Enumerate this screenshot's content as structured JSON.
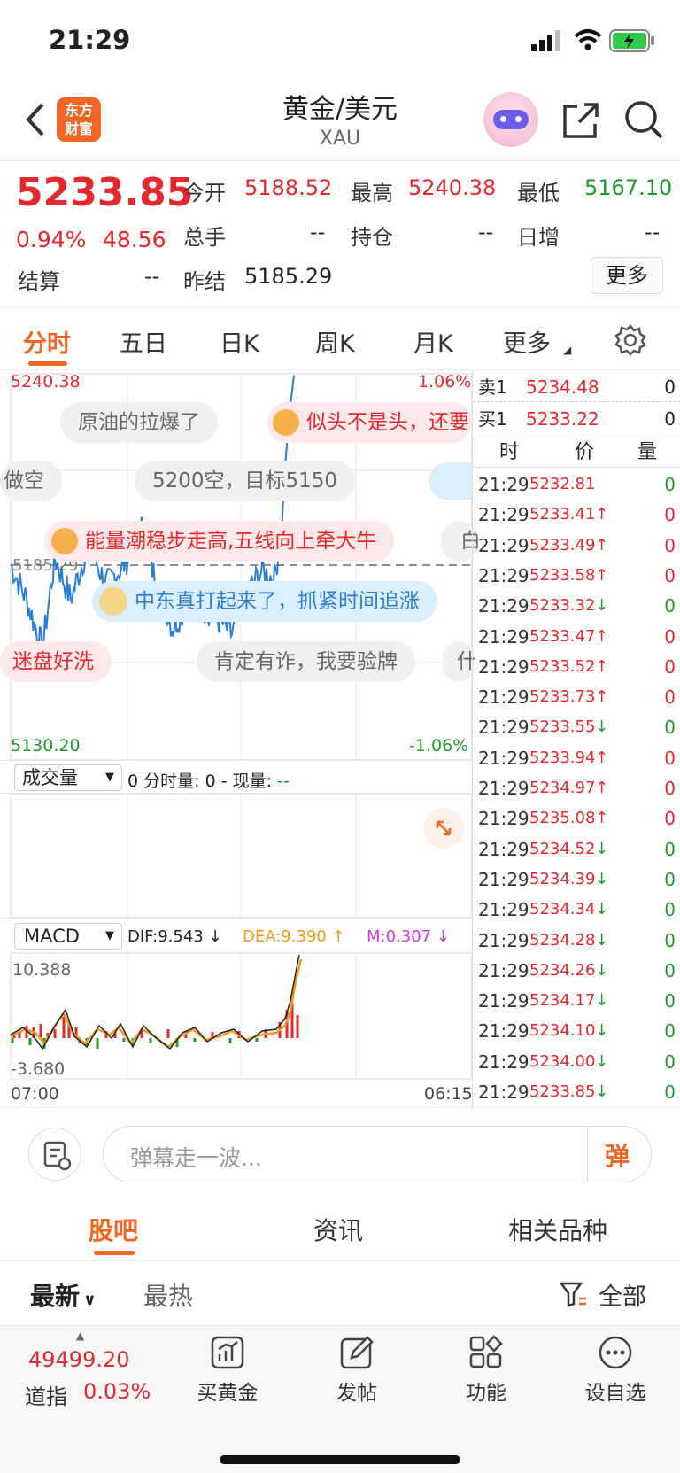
{
  "status_bar": {
    "time": "21:29"
  },
  "header": {
    "title": "黄金/美元",
    "subtitle": "XAU",
    "logo_line1": "东方",
    "logo_line2": "财富"
  },
  "quote": {
    "price": "5233.85",
    "change_pct": "0.94%",
    "change": "48.56",
    "open_label": "今开",
    "open": "5188.52",
    "high_label": "最高",
    "high": "5240.38",
    "low_label": "最低",
    "low": "5167.10",
    "volume_label": "总手",
    "volume": "--",
    "position_label": "持仓",
    "position": "--",
    "daily_inc_label": "日增",
    "daily_inc": "--",
    "settle_label": "结算",
    "settle": "--",
    "prev_settle_label": "昨结",
    "prev_settle": "5185.29",
    "more_button": "更多"
  },
  "tabs": {
    "t1": "分时",
    "t2": "五日",
    "t3": "日K",
    "t4": "周K",
    "t5": "月K",
    "t6": "更多"
  },
  "chart": {
    "y_max": "5240.38",
    "y_min": "5130.20",
    "pct_max": "1.06%",
    "pct_min": "-1.06%",
    "prev_close": "5185.29",
    "volume_selector": "成交量",
    "volume_info_a": "0 分时量: 0 - 现量:",
    "volume_info_b": "--",
    "macd_selector": "MACD",
    "dif": "DIF:9.543 ↓",
    "dea": "DEA:9.390 ↑",
    "m": "M:0.307 ↓",
    "macd_max": "10.388",
    "macd_min": "-3.680",
    "time_start": "07:00",
    "time_end": "06:15"
  },
  "chart_data": {
    "type": "line",
    "title": "",
    "ylim": [
      5130.2,
      5240.38
    ],
    "x_range": [
      "07:00",
      "06:15"
    ],
    "prev_close": 5185.29
  },
  "danmaku": {
    "d1": "原油的拉爆了",
    "d2": "似头不是头，还要",
    "d3": "做空",
    "d4": "5200空，目标5150",
    "d5": "能量潮稳步走高,五线向上牵大牛",
    "d6": "白",
    "d7": "中东真打起来了，抓紧时间追涨",
    "d8": "迷盘好洗",
    "d9": "肯定有诈，我要验牌",
    "d10": "什"
  },
  "order_book": {
    "ask_label": "卖1",
    "ask_price": "5234.48",
    "ask_vol": "0",
    "bid_label": "买1",
    "bid_price": "5233.22",
    "bid_vol": "0",
    "head_time": "时",
    "head_price": "价",
    "head_vol": "量"
  },
  "ticks": [
    {
      "t": "21:29",
      "p": "5232.81",
      "a": "",
      "v": "0",
      "c": "red",
      "vc": "green"
    },
    {
      "t": "21:29",
      "p": "5233.41",
      "a": "↑",
      "v": "0",
      "c": "red",
      "vc": "red"
    },
    {
      "t": "21:29",
      "p": "5233.49",
      "a": "↑",
      "v": "0",
      "c": "red",
      "vc": "red"
    },
    {
      "t": "21:29",
      "p": "5233.58",
      "a": "↑",
      "v": "0",
      "c": "red",
      "vc": "red"
    },
    {
      "t": "21:29",
      "p": "5233.32",
      "a": "↓",
      "v": "0",
      "c": "red",
      "vc": "green"
    },
    {
      "t": "21:29",
      "p": "5233.47",
      "a": "↑",
      "v": "0",
      "c": "red",
      "vc": "red"
    },
    {
      "t": "21:29",
      "p": "5233.52",
      "a": "↑",
      "v": "0",
      "c": "red",
      "vc": "red"
    },
    {
      "t": "21:29",
      "p": "5233.73",
      "a": "↑",
      "v": "0",
      "c": "red",
      "vc": "red"
    },
    {
      "t": "21:29",
      "p": "5233.55",
      "a": "↓",
      "v": "0",
      "c": "red",
      "vc": "green"
    },
    {
      "t": "21:29",
      "p": "5233.94",
      "a": "↑",
      "v": "0",
      "c": "red",
      "vc": "red"
    },
    {
      "t": "21:29",
      "p": "5234.97",
      "a": "↑",
      "v": "0",
      "c": "red",
      "vc": "red"
    },
    {
      "t": "21:29",
      "p": "5235.08",
      "a": "↑",
      "v": "0",
      "c": "red",
      "vc": "red"
    },
    {
      "t": "21:29",
      "p": "5234.52",
      "a": "↓",
      "v": "0",
      "c": "red",
      "vc": "green"
    },
    {
      "t": "21:29",
      "p": "5234.39",
      "a": "↓",
      "v": "0",
      "c": "red",
      "vc": "green"
    },
    {
      "t": "21:29",
      "p": "5234.34",
      "a": "↓",
      "v": "0",
      "c": "red",
      "vc": "green"
    },
    {
      "t": "21:29",
      "p": "5234.28",
      "a": "↓",
      "v": "0",
      "c": "red",
      "vc": "green"
    },
    {
      "t": "21:29",
      "p": "5234.26",
      "a": "↓",
      "v": "0",
      "c": "red",
      "vc": "green"
    },
    {
      "t": "21:29",
      "p": "5234.17",
      "a": "↓",
      "v": "0",
      "c": "red",
      "vc": "green"
    },
    {
      "t": "21:29",
      "p": "5234.10",
      "a": "↓",
      "v": "0",
      "c": "red",
      "vc": "green"
    },
    {
      "t": "21:29",
      "p": "5234.00",
      "a": "↓",
      "v": "0",
      "c": "red",
      "vc": "green"
    },
    {
      "t": "21:29",
      "p": "5233.85",
      "a": "↓",
      "v": "0",
      "c": "red",
      "vc": "green"
    }
  ],
  "input": {
    "placeholder": "弹幕走一波...",
    "send_glyph": "弹"
  },
  "sections": {
    "s1": "股吧",
    "s2": "资讯",
    "s3": "相关品种"
  },
  "filter": {
    "latest": "最新",
    "hot": "最热",
    "all": "全部"
  },
  "bottom_bar": {
    "index_value": "49499.20",
    "index_name": "道指",
    "index_pct": "0.03%",
    "b1": "买黄金",
    "b2": "发帖",
    "b3": "功能",
    "b4": "设自选"
  },
  "colors": {
    "up": "#e3282e",
    "down": "#1e9a2a",
    "accent": "#f26522",
    "line": "#2a7fd4"
  }
}
